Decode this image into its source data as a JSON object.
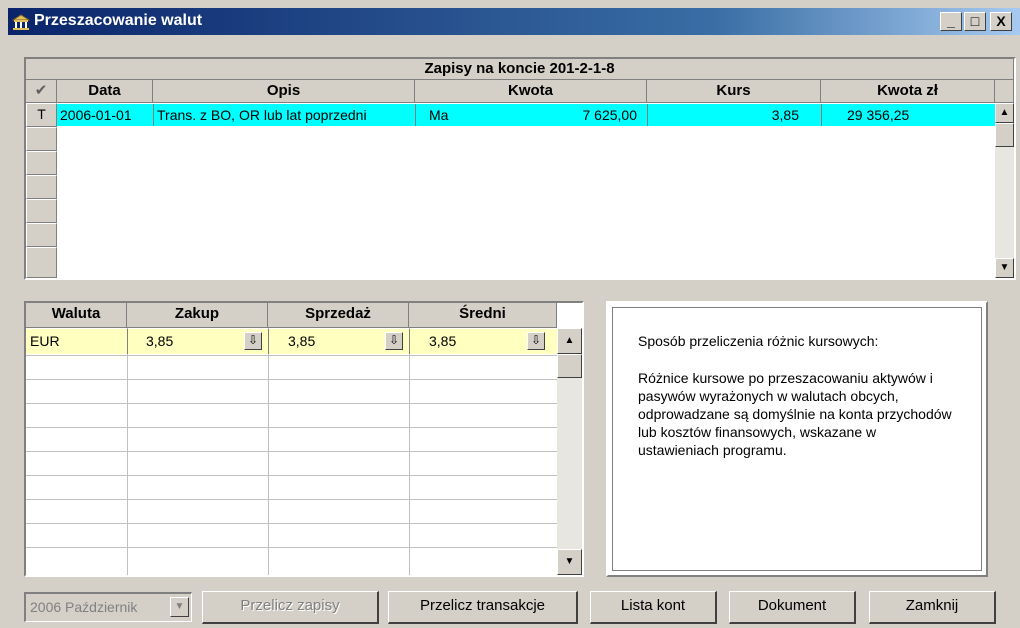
{
  "window": {
    "title": "Przeszacowanie walut",
    "controls": {
      "minimize": "_",
      "maximize": "□",
      "close": "X"
    }
  },
  "entries": {
    "caption": "Zapisy na koncie 201-2-1-8",
    "check_col": "✔",
    "columns": [
      "Data",
      "Opis",
      "Kwota",
      "Kurs",
      "Kwota zł"
    ],
    "rows": [
      {
        "marker": "T",
        "data": "2006-01-01",
        "opis": "Trans. z BO, OR lub lat poprzedni",
        "strona": "Ma",
        "kwota": "7 625,00",
        "kurs": "3,85",
        "kwota_zl": "29 356,25"
      }
    ],
    "highlight_color": "#00ffff"
  },
  "rates": {
    "columns": [
      "Waluta",
      "Zakup",
      "Sprzedaż",
      "Średni"
    ],
    "rows": [
      {
        "waluta": "EUR",
        "zakup": "3,85",
        "sprzedaz": "3,85",
        "sredni": "3,85"
      }
    ],
    "highlight_color": "#ffffc0"
  },
  "info": {
    "heading": "Sposób przeliczenia różnic kursowych:",
    "body": "Różnice kursowe po przeszacowaniu aktywów i pasywów wyrażonych w walutach obcych, odprowadzane są domyślnie na konta przychodów lub kosztów finansowych, wskazane w ustawieniach programu."
  },
  "footer": {
    "period": "2006 Październik",
    "buttons": {
      "przelicz_zapisy": "Przelicz zapisy",
      "przelicz_transakcje": "Przelicz transakcje",
      "lista_kont": "Lista kont",
      "dokument": "Dokument",
      "zamknij": "Zamknij"
    }
  }
}
